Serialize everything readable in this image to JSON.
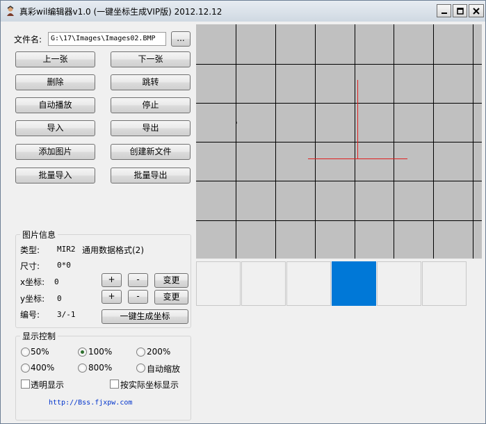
{
  "window": {
    "title": "真彩wil编辑器v1.0 (一键坐标生成VIP版) 2012.12.12"
  },
  "file": {
    "label": "文件名:",
    "path": "G:\\17\\Images\\Images02.BMP",
    "browse_label": "..."
  },
  "buttons": {
    "prev": "上一张",
    "next": "下一张",
    "delete": "删除",
    "jump": "跳转",
    "autoplay": "自动播放",
    "stop": "停止",
    "import": "导入",
    "export": "导出",
    "add_image": "添加图片",
    "new_file": "创建新文件",
    "batch_import": "批量导入",
    "batch_export": "批量导出"
  },
  "info": {
    "title": "图片信息",
    "type_label": "类型:",
    "type_value": "MIR2",
    "type_desc": "通用数据格式(2)",
    "size_label": "尺寸:",
    "size_value": "0*0",
    "x_label": "x坐标:",
    "x_value": "0",
    "y_label": "y坐标:",
    "y_value": "0",
    "num_label": "编号:",
    "num_value": "3/-1",
    "plus": "+",
    "minus": "-",
    "change": "变更",
    "gen_coords": "一键生成坐标"
  },
  "display": {
    "title": "显示控制",
    "zoom_options": [
      "50%",
      "100%",
      "200%",
      "400%",
      "800%",
      "自动缩放"
    ],
    "selected_zoom": "100%",
    "transparent_label": "透明显示",
    "actual_coords_label": "按实际坐标显示"
  },
  "link": {
    "text": "http://Bss.fjxpw.com"
  },
  "colors": {
    "canvas_bg": "#c0c0c0",
    "grid_line": "#000000",
    "cross": "#e02020",
    "selection": "#0078d7"
  },
  "thumbnails": {
    "count": 6,
    "selected_index": 3
  }
}
